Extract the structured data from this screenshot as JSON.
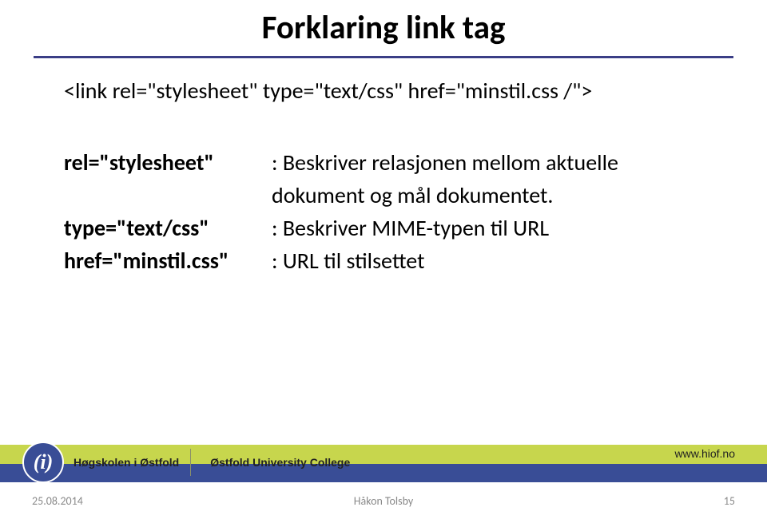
{
  "title": "Forklaring link tag",
  "intro": "<link rel=\"stylesheet\" type=\"text/css\" href=\"minstil.css /\">",
  "rows": [
    {
      "term": "rel=\"stylesheet\"",
      "def": ": Beskriver relasjonen mellom aktuelle"
    },
    {
      "term": "",
      "def": "  dokument og mål dokumentet.",
      "cont": true
    },
    {
      "term": "type=\"text/css\"",
      "def": ": Beskriver MIME-typen til URL"
    },
    {
      "term": "href=\"minstil.css\"",
      "def": ": URL til stilsettet"
    }
  ],
  "institution_no": "Høgskolen i Østfold",
  "institution_en": "Østfold University College",
  "url": "www.hiof.no",
  "footer": {
    "date": "25.08.2014",
    "author": "Håkon Tolsby",
    "page": "15"
  },
  "logo_glyph": "(i)"
}
